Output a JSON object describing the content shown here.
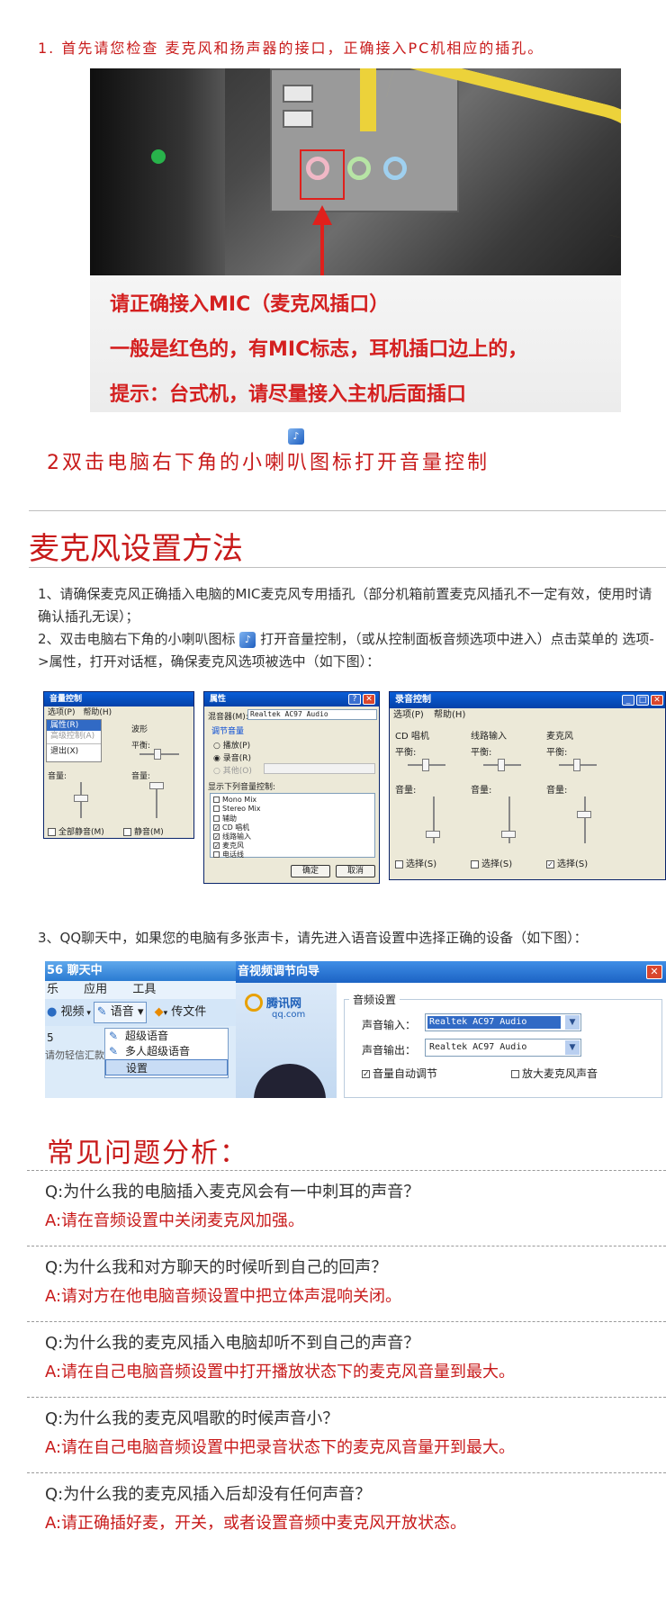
{
  "step1": {
    "text": "1. 首先请您检查 麦克风和扬声器的接口，正确接入PC机相应的插孔。"
  },
  "photo": {
    "line1": "请正确接入MIC（麦克风插口）",
    "line2": "一般是红色的，有MIC标志，耳机插口边上的，",
    "line3": "提示：台式机，请尽量接入主机后面插口"
  },
  "step2": {
    "text": "2双击电脑右下角的小喇叭图标打开音量控制",
    "icon": "speaker-icon"
  },
  "section": {
    "title": "麦克风设置方法",
    "p1": "1、请确保麦克风正确插入电脑的MIC麦克风专用插孔（部分机箱前置麦克风插孔不一定有效，使用时请确认插孔无误）；",
    "p2a": "2、双击电脑右下角的小喇叭图标",
    "p2b": "打开音量控制，（或从控制面板音频选项中进入）点击菜单的 选项->属性，打开对话框，确保麦克风选项被选中（如下图）：",
    "p3": "3、QQ聊天中，如果您的电脑有多张声卡，请先进入语音设置中选择正确的设备（如下图）："
  },
  "win_volume": {
    "title": "音量控制",
    "menu_options": "选项(P)",
    "menu_help": "帮助(H)",
    "item_props": "属性(R)",
    "item_advanced": "高级控制(A)",
    "item_exit": "退出(X)",
    "col_wave": "波形",
    "balance": "平衡:",
    "volume": "音量:",
    "mute_all": "全部静音(M)",
    "mute": "静音(M)"
  },
  "win_props": {
    "title": "属性",
    "mixer_label": "混音器(M):",
    "mixer_value": "Realtek AC97 Audio",
    "adjust_group": "调节音量",
    "radio_play": "播放(P)",
    "radio_record": "录音(R)",
    "radio_other": "其他(O)",
    "list_label": "显示下列音量控制:",
    "items": [
      "Mono Mix",
      "Stereo Mix",
      "辅助",
      "CD 唱机",
      "线路输入",
      "麦克风",
      "电话线"
    ],
    "checked": [
      false,
      false,
      false,
      true,
      true,
      true,
      false
    ],
    "ok": "确定",
    "cancel": "取消"
  },
  "win_record": {
    "title": "录音控制",
    "menu_options": "选项(P)",
    "menu_help": "帮助(H)",
    "columns": [
      "CD 唱机",
      "线路输入",
      "麦克风"
    ],
    "balance": "平衡:",
    "volume": "音量:",
    "select": "选择(S)",
    "selected": [
      false,
      false,
      true
    ]
  },
  "qq_left": {
    "title": "56  聊天中",
    "menu_music": "乐",
    "menu_app": "应用",
    "menu_tools": "工具",
    "video": "视频",
    "voice": "语音",
    "transfer": "传文件",
    "item1": "超级语音",
    "item2": "多人超级语音",
    "item3": "设置",
    "side_num": "5",
    "side_text": "请勿轻信汇款"
  },
  "qq_right": {
    "title": "音视频调节向导",
    "logo": "腾讯网",
    "logo_sub": "qq.com",
    "group": "音频设置",
    "input_label": "声音输入：",
    "input_value": "Realtek AC97 Audio",
    "output_label": "声音输出：",
    "output_value": "Realtek AC97 Audio",
    "auto_adjust": "音量自动调节",
    "amplify": "放大麦克风声音"
  },
  "faq": {
    "title": "常见问题分析：",
    "items": [
      {
        "q": "Q:为什么我的电脑插入麦克风会有一中刺耳的声音？",
        "a": "A:请在音频设置中关闭麦克风加强。"
      },
      {
        "q": "Q:为什么我和对方聊天的时候听到自己的回声？",
        "a": "A:请对方在他电脑音频设置中把立体声混响关闭。"
      },
      {
        "q": "Q:为什么我的麦克风插入电脑却听不到自己的声音？",
        "a": "A:请在自己电脑音频设置中打开播放状态下的麦克风音量到最大。"
      },
      {
        "q": "Q:为什么我的麦克风唱歌的时候声音小？",
        "a": "A:请在自己电脑音频设置中把录音状态下的麦克风音量开到最大。"
      },
      {
        "q": "Q:为什么我的麦克风插入后却没有任何声音？",
        "a": "A:请正确插好麦，开关，或者设置音频中麦克风开放状态。"
      }
    ]
  }
}
